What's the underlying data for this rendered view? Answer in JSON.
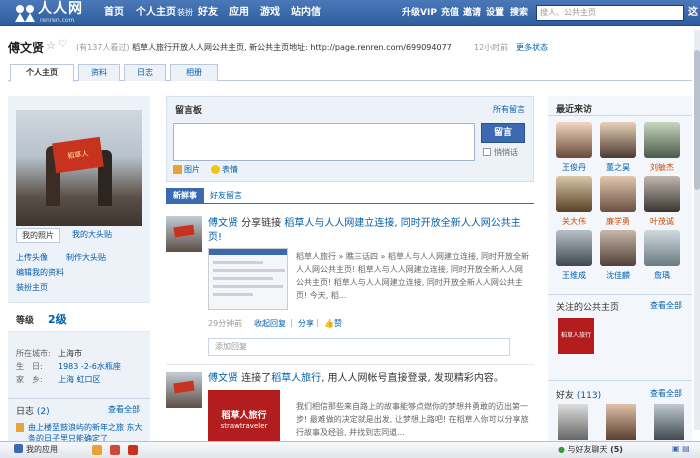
{
  "nav": {
    "logo_text": "人人网",
    "logo_sub": "renren.com",
    "items": [
      "首页",
      "个人主页",
      "装扮",
      "好友",
      "应用",
      "游戏",
      "站内信"
    ],
    "right_items": [
      "升级VIP",
      "充值",
      "邀请",
      "设置",
      "搜索"
    ],
    "search_placeholder": "搜人、公共主页",
    "search_cut": "这"
  },
  "profile": {
    "name": "傅文贤",
    "views": "(有137人看过)",
    "status": "稻草人旅行开放人人网公共主页, 新公共主页地址: http://page.renren.com/699094077",
    "time": "12小时前",
    "more_status": "更多状态"
  },
  "tabs": [
    "个人主页",
    "资料",
    "日志",
    "相册"
  ],
  "left": {
    "banner_text": "稻草人",
    "photo_tabs": [
      "我的照片",
      "我的大头贴"
    ],
    "links": [
      "上传头像",
      "制作大头贴",
      "编辑我的资料",
      "装扮主页"
    ],
    "level_label": "等级",
    "level_value": "2级",
    "info": [
      {
        "k": "所在城市:",
        "v": "上海市"
      },
      {
        "k": "生　日:",
        "v": "1983 -2-6水瓶座"
      },
      {
        "k": "家　乡:",
        "v": "上海 虹口区"
      }
    ],
    "blog_title": "日志",
    "blog_count": "(2)",
    "blog_more": "查看全部",
    "blog_item": "由上楼至鼓浪屿的新年之旅 东大条的日子里只能确定了"
  },
  "board": {
    "title": "留言板",
    "all": "所有留言",
    "send": "留言",
    "whisper": "悄悄话",
    "tools": [
      "图片",
      "表情"
    ]
  },
  "feed_tabs": [
    "新鲜事",
    "好友留言"
  ],
  "feed": [
    {
      "name": "傅文贤",
      "action": " 分享链接 ",
      "link": "稻草人与人人网建立连接, 同时开放全新人人网公共主页!",
      "desc": "稻草人旅行 » 瞧三话四 » 稻草人与人人网建立连接, 同时开放全新人人网公共主页! 稻草人与人人网建立连接, 同时开放全新人人网公共主页! 稻草人与人人网建立连接, 同时开放全新人人网公共主页! 今天, 稻...",
      "time": "29分钟前",
      "actions": [
        "收起回复",
        "分享",
        "赞"
      ],
      "reply_placeholder": "添加回复"
    },
    {
      "name": "傅文贤",
      "action": " 连接了",
      "link": "稻草人旅行",
      "action2": ", 用人人网帐号直接登录, 发现精彩内容。",
      "brand_cn": "稻草人旅行",
      "brand_en": "strawtraveler",
      "desc": "我们相信那些来自路上的故事能够点燃你的梦想并勇敢的迈出第一步! 最难做的决定就是出发, 让梦想上路吧! 在稻草人你可以分享旅行故事及经验, 并找到志同道..."
    }
  ],
  "right": {
    "visitors_title": "最近来访",
    "visitors": [
      {
        "name": "王俊丹",
        "color": "#005eac"
      },
      {
        "name": "董之昊",
        "color": "#005eac"
      },
      {
        "name": "刘敏杰",
        "color": "#d04a00"
      },
      {
        "name": "关大伟",
        "color": "#d04a00"
      },
      {
        "name": "廉学勇",
        "color": "#d04a00"
      },
      {
        "name": "叶茂诚",
        "color": "#d04a00"
      },
      {
        "name": "王维成",
        "color": "#005eac"
      },
      {
        "name": "沈佳麟",
        "color": "#005eac"
      },
      {
        "name": "詹瑀",
        "color": "#005eac"
      }
    ],
    "pages_title": "关注的公共主页",
    "pages_more": "查看全部",
    "page_logo_text": "稻草人旅行",
    "friends_title": "好友",
    "friends_count": "(113)",
    "friends_more": "查看全部"
  },
  "bottom": {
    "my_apps": "我的应用",
    "chat": "与好友聊天",
    "chat_count": "(5)"
  }
}
